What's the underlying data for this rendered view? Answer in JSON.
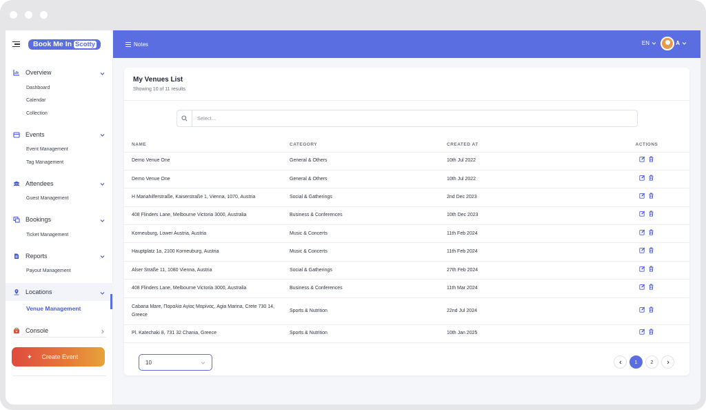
{
  "brand": {
    "name": "Book Me In",
    "badge": "Scotty"
  },
  "colors": {
    "accent": "#5b6ee1",
    "cta_start": "#e04a3f",
    "cta_end": "#e6a33a"
  },
  "sidebar": {
    "sections": [
      {
        "label": "Overview",
        "icon": "chart-icon",
        "items": [
          "Dashboard",
          "Calendar",
          "Collection"
        ]
      },
      {
        "label": "Events",
        "icon": "calendar-icon",
        "items": [
          "Event Management",
          "Tag Management"
        ]
      },
      {
        "label": "Attendees",
        "icon": "people-icon",
        "items": [
          "Guest Management"
        ]
      },
      {
        "label": "Bookings",
        "icon": "ticket-icon",
        "items": [
          "Ticket Management"
        ]
      },
      {
        "label": "Reports",
        "icon": "report-icon",
        "items": [
          "Payout Management"
        ]
      },
      {
        "label": "Locations",
        "icon": "pin-icon",
        "items": [
          "Venue Management"
        ]
      },
      {
        "label": "Console",
        "icon": "console-icon",
        "items": []
      }
    ],
    "active_item": "Venue Management",
    "create_button": "Create Event"
  },
  "topbar": {
    "notes": "Notes",
    "lang": "EN",
    "user_initial": "A"
  },
  "venues": {
    "title": "My Venues List",
    "subtitle": "Showing 10 of 11 results",
    "search_placeholder": "Select...",
    "columns": [
      "NAME",
      "CATEGORY",
      "CREATED AT",
      "ACTIONS"
    ],
    "rows": [
      {
        "name": "Demo Venue One",
        "category": "General & Others",
        "created": "10th Jul 2022"
      },
      {
        "name": "Demo Venue One",
        "category": "General & Others",
        "created": "10th Jul 2022"
      },
      {
        "name": "H Mariahilferstraße, Kaiserstraße 1, Vienna, 1070, Austria",
        "category": "Social & Gatherings",
        "created": "2nd Dec 2023"
      },
      {
        "name": "408 Flinders Lane, Melbourne Victoria 3000, Australia",
        "category": "Business & Conferences",
        "created": "10th Dec 2023"
      },
      {
        "name": "Korneuburg, Lower Austria, Austria",
        "category": "Music & Concerts",
        "created": "11th Feb 2024"
      },
      {
        "name": "Hauptplatz 1a, 2100 Korneuburg, Austria",
        "category": "Music & Concerts",
        "created": "11th Feb 2024"
      },
      {
        "name": "Alser Straße 11, 1080 Vienna, Austria",
        "category": "Social & Gatherings",
        "created": "27th Feb 2024"
      },
      {
        "name": "408 Flinders Lane, Melbourne Victoria 3000, Australia",
        "category": "Business & Conferences",
        "created": "11th Mar 2024"
      },
      {
        "name": "Cabana Mare, Παραλία Αγίας Μαρίνας, Agia Marina, Crete 730 14, Greece",
        "category": "Sports & Nutrition",
        "created": "22nd Jul 2024"
      },
      {
        "name": "Pl. Katechaki 8, 731 32 Chania, Greece",
        "category": "Sports & Nutrition",
        "created": "10th Jan 2025"
      }
    ],
    "page_size": "10",
    "pages": [
      "1",
      "2"
    ],
    "current_page": "1"
  }
}
